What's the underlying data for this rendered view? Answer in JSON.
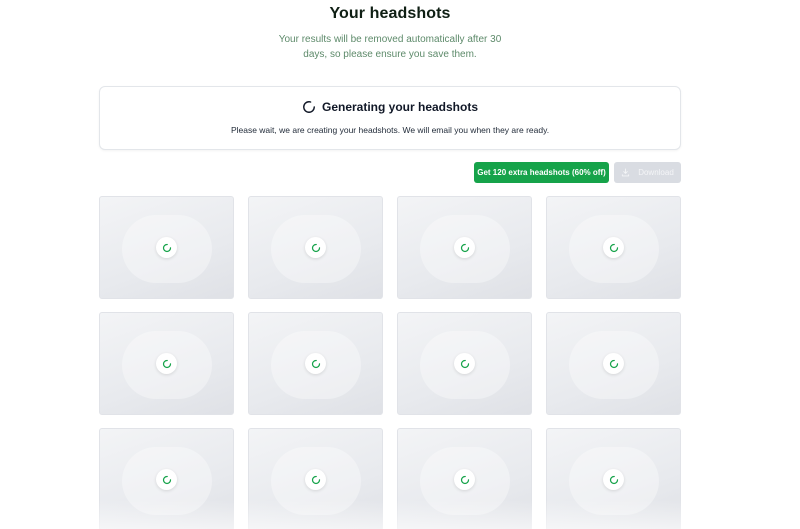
{
  "page": {
    "title": "Your headshots",
    "subtitle": "Your results will be removed automatically after 30 days, so please ensure you save them."
  },
  "status": {
    "title": "Generating your headshots",
    "message": "Please wait, we are creating your headshots. We will email you when they are ready.",
    "icon": "spinner-icon"
  },
  "actions": {
    "upsell_label": "Get 120 extra headshots (60% off)",
    "download_label": "Download",
    "download_icon": "download-icon",
    "download_disabled": true
  },
  "colors": {
    "accent": "#16a34a",
    "subtitle": "#5d8a6a",
    "tile_bg": "#e8eaee",
    "disabled_button": "#d9dce2"
  },
  "grid": {
    "tiles": [
      {
        "state": "loading"
      },
      {
        "state": "loading"
      },
      {
        "state": "loading"
      },
      {
        "state": "loading"
      },
      {
        "state": "loading"
      },
      {
        "state": "loading"
      },
      {
        "state": "loading"
      },
      {
        "state": "loading"
      },
      {
        "state": "loading"
      },
      {
        "state": "loading"
      },
      {
        "state": "loading"
      },
      {
        "state": "loading"
      }
    ]
  }
}
